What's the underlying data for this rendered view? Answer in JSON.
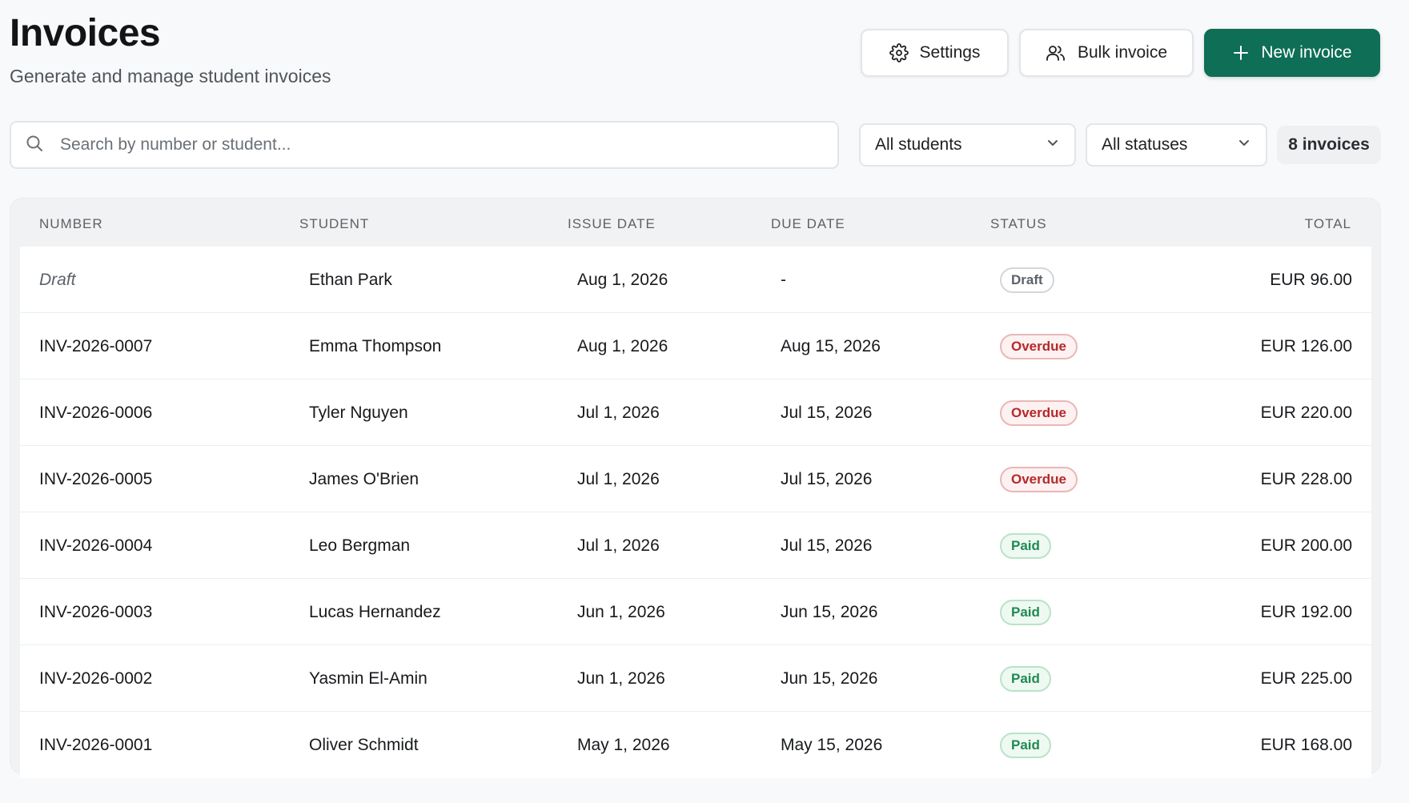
{
  "header": {
    "title": "Invoices",
    "subtitle": "Generate and manage student invoices",
    "actions": {
      "settings_label": "Settings",
      "bulk_label": "Bulk invoice",
      "new_label": "New invoice"
    }
  },
  "filters": {
    "search_placeholder": "Search by number or student...",
    "students_value": "All students",
    "statuses_value": "All statuses",
    "count_label": "8 invoices"
  },
  "table": {
    "columns": {
      "number": "NUMBER",
      "student": "STUDENT",
      "issue_date": "ISSUE DATE",
      "due_date": "DUE DATE",
      "status": "STATUS",
      "total": "TOTAL"
    },
    "rows": [
      {
        "number": "Draft",
        "student": "Ethan Park",
        "issue_date": "Aug 1, 2026",
        "due_date": "-",
        "status": "Draft",
        "total": "EUR 96.00"
      },
      {
        "number": "INV-2026-0007",
        "student": "Emma Thompson",
        "issue_date": "Aug 1, 2026",
        "due_date": "Aug 15, 2026",
        "status": "Overdue",
        "total": "EUR 126.00"
      },
      {
        "number": "INV-2026-0006",
        "student": "Tyler Nguyen",
        "issue_date": "Jul 1, 2026",
        "due_date": "Jul 15, 2026",
        "status": "Overdue",
        "total": "EUR 220.00"
      },
      {
        "number": "INV-2026-0005",
        "student": "James O'Brien",
        "issue_date": "Jul 1, 2026",
        "due_date": "Jul 15, 2026",
        "status": "Overdue",
        "total": "EUR 228.00"
      },
      {
        "number": "INV-2026-0004",
        "student": "Leo Bergman",
        "issue_date": "Jul 1, 2026",
        "due_date": "Jul 15, 2026",
        "status": "Paid",
        "total": "EUR 200.00"
      },
      {
        "number": "INV-2026-0003",
        "student": "Lucas Hernandez",
        "issue_date": "Jun 1, 2026",
        "due_date": "Jun 15, 2026",
        "status": "Paid",
        "total": "EUR 192.00"
      },
      {
        "number": "INV-2026-0002",
        "student": "Yasmin El-Amin",
        "issue_date": "Jun 1, 2026",
        "due_date": "Jun 15, 2026",
        "status": "Paid",
        "total": "EUR 225.00"
      },
      {
        "number": "INV-2026-0001",
        "student": "Oliver Schmidt",
        "issue_date": "May 1, 2026",
        "due_date": "May 15, 2026",
        "status": "Paid",
        "total": "EUR 168.00"
      }
    ]
  },
  "icons": {
    "settings": "gear-icon",
    "bulk": "users-icon",
    "new": "plus-icon",
    "search": "search-icon",
    "dropdown": "chevron-down-icon"
  },
  "colors": {
    "primary": "#0e6e56",
    "overdue": "#b42a2a",
    "paid": "#1f8a52",
    "draft": "#5c6268"
  }
}
